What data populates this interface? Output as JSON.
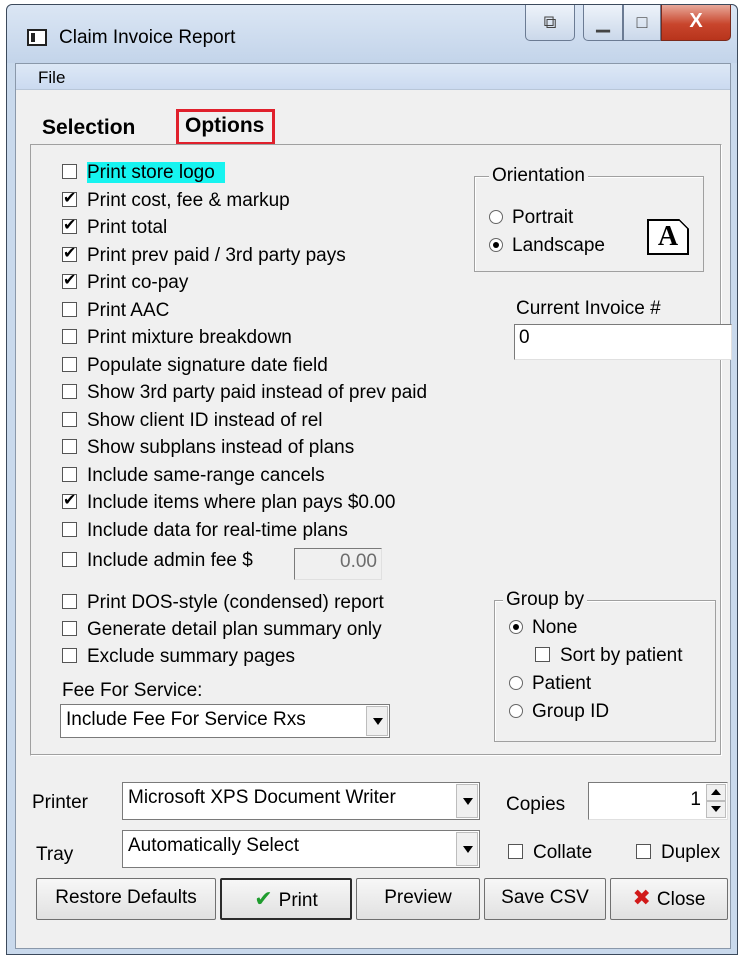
{
  "window": {
    "title": "Claim Invoice Report"
  },
  "titlebar": {
    "restore": "⧉",
    "minimize": "▁",
    "maximize": "□",
    "close": "X"
  },
  "menu": {
    "file": "File"
  },
  "tabs": {
    "selection": "Selection",
    "options": "Options"
  },
  "options": [
    {
      "label": "Print store logo",
      "checked": false
    },
    {
      "label": "Print cost, fee & markup",
      "checked": true
    },
    {
      "label": "Print total",
      "checked": true
    },
    {
      "label": "Print prev paid / 3rd party pays",
      "checked": true
    },
    {
      "label": "Print co-pay",
      "checked": true
    },
    {
      "label": "Print AAC",
      "checked": false
    },
    {
      "label": "Print mixture breakdown",
      "checked": false
    },
    {
      "label": "Populate signature date field",
      "checked": false
    },
    {
      "label": "Show 3rd party paid instead of prev paid",
      "checked": false
    },
    {
      "label": "Show client ID instead of rel",
      "checked": false
    },
    {
      "label": "Show subplans instead of plans",
      "checked": false
    },
    {
      "label": "Include same-range cancels",
      "checked": false
    },
    {
      "label": "Include items where plan pays $0.00",
      "checked": true
    },
    {
      "label": "Include data for real-time plans",
      "checked": false
    }
  ],
  "admin_fee": {
    "label": "Include admin fee $",
    "checked": false,
    "value": "0.00"
  },
  "lower_options": [
    {
      "label": "Print DOS-style (condensed) report",
      "checked": false
    },
    {
      "label": "Generate detail plan summary only",
      "checked": false
    },
    {
      "label": "Exclude summary pages",
      "checked": false
    }
  ],
  "fee_for_service": {
    "label": "Fee For Service:",
    "value": "Include Fee For Service Rxs"
  },
  "orientation": {
    "title": "Orientation",
    "portrait": "Portrait",
    "landscape": "Landscape",
    "selected": "Landscape",
    "icon_letter": "A"
  },
  "invoice": {
    "label": "Current Invoice #",
    "value": "0"
  },
  "group_by": {
    "title": "Group by",
    "none": "None",
    "sort_by_patient": "Sort by patient",
    "patient": "Patient",
    "group_id": "Group ID",
    "selected": "None"
  },
  "printer": {
    "label": "Printer",
    "value": "Microsoft XPS Document Writer"
  },
  "tray": {
    "label": "Tray",
    "value": "Automatically Select"
  },
  "copies": {
    "label": "Copies",
    "value": "1"
  },
  "collate": {
    "label": "Collate",
    "checked": false
  },
  "duplex": {
    "label": "Duplex",
    "checked": false
  },
  "buttons": {
    "restore_defaults": "Restore Defaults",
    "print": "Print",
    "preview": "Preview",
    "save_csv": "Save CSV",
    "close": "Close"
  },
  "colors": {
    "highlight": "#16f4f0",
    "tab_outline": "#e0202c",
    "print_check": "#1f9c2e",
    "close_x": "#d11a1a"
  }
}
